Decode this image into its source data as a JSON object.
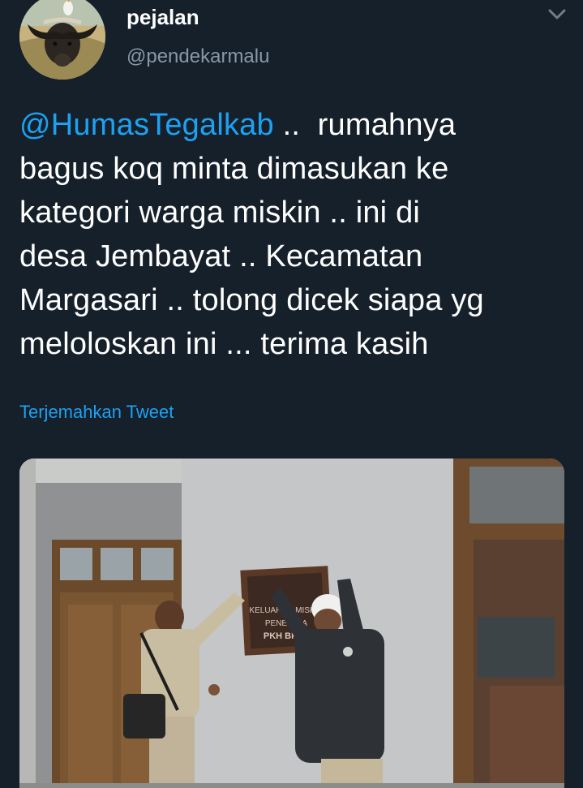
{
  "tweet": {
    "author": {
      "display_name": "pejalan",
      "handle": "@pendekarmalu",
      "avatar_icon": "buffalo-avatar"
    },
    "text_lines": [
      {
        "mention": "@HumasTegalkab",
        "text": " ..  rumahnya"
      },
      {
        "mention": "",
        "text": "bagus koq minta dimasukan ke"
      },
      {
        "mention": "",
        "text": "kategori warga miskin .. ini di"
      },
      {
        "mention": "",
        "text": "desa Jembayat .. Kecamatan"
      },
      {
        "mention": "",
        "text": "Margasari .. tolong dicek siapa yg"
      },
      {
        "mention": "",
        "text": "meloloskan ini ... terima kasih"
      }
    ],
    "translate_label": "Terjemahkan Tweet",
    "menu_icon": "chevron-down-icon",
    "media": {
      "sign_lines": [
        "KELUARGA MISKIN",
        "PENERIMA",
        "PKH BPNT"
      ]
    }
  },
  "colors": {
    "background": "#15202b",
    "accent": "#1da1f2",
    "secondary_text": "#8899a6",
    "primary_text": "#ffffff"
  }
}
